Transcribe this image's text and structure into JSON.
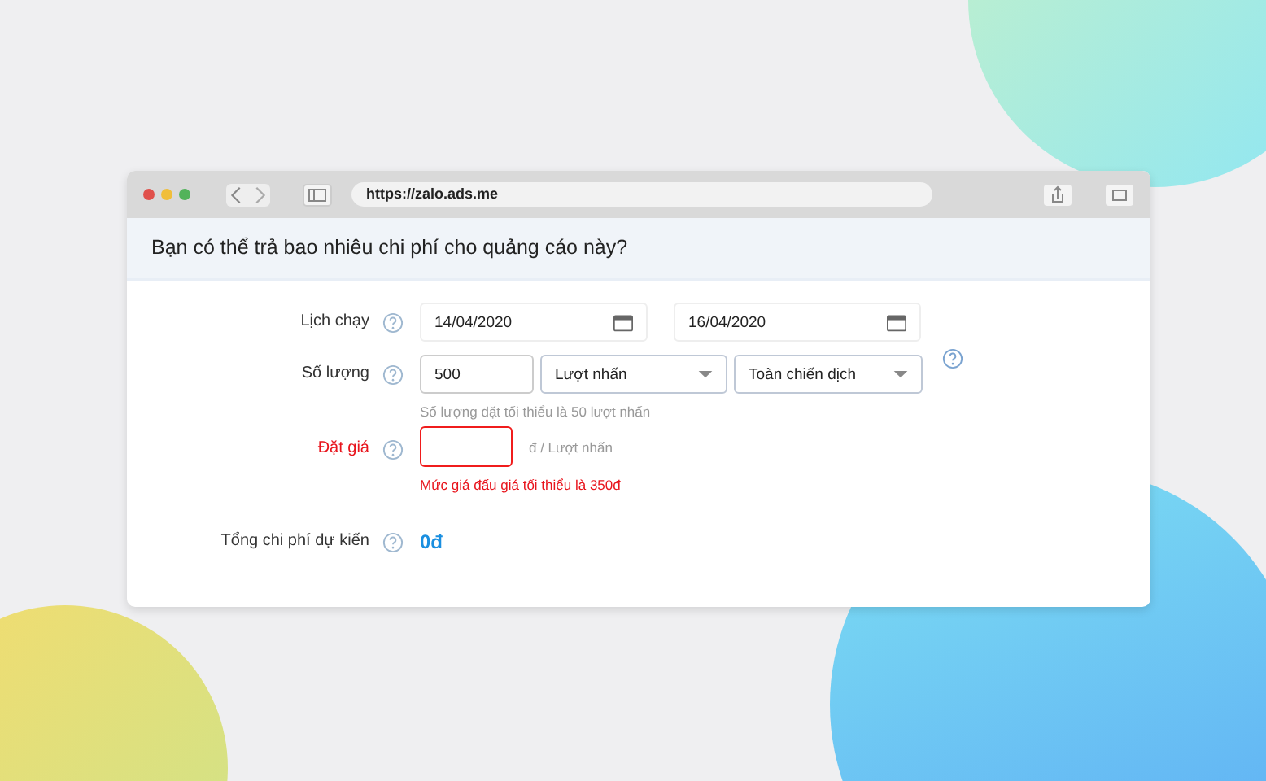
{
  "browser": {
    "url": "https://zalo.ads.me"
  },
  "heading": "Bạn có thể trả bao nhiêu chi phí cho quảng cáo này?",
  "rows": [
    {
      "kind": "dates",
      "label": "Lịch chạy",
      "error": false,
      "fields": [
        {
          "value": "14/04/2020"
        },
        {
          "value": "16/04/2020"
        }
      ]
    },
    {
      "kind": "quantity",
      "label": "Số lượng",
      "error": false,
      "value": "500",
      "selects": [
        {
          "value": "Lượt nhấn"
        },
        {
          "value": "Toàn chiến dịch"
        }
      ],
      "hint": "Số lượng đặt tối thiểu là 50 lượt nhấn"
    },
    {
      "kind": "bid",
      "label": "Đặt giá",
      "error": true,
      "value": "",
      "unit": "đ / Lượt nhấn",
      "message": "Mức giá đấu giá tối thiểu là 350đ"
    },
    {
      "kind": "total",
      "label": "Tổng chi phí dự kiến",
      "error": false,
      "value": "0đ"
    }
  ]
}
